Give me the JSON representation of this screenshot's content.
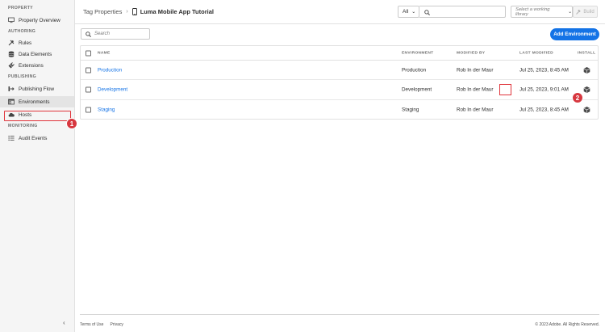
{
  "sidebar": {
    "sections": [
      {
        "label": "PROPERTY"
      },
      {
        "label": "AUTHORING"
      },
      {
        "label": "PUBLISHING"
      },
      {
        "label": "MONITORING"
      }
    ],
    "items": [
      {
        "label": "Property Overview"
      },
      {
        "label": "Rules"
      },
      {
        "label": "Data Elements"
      },
      {
        "label": "Extensions"
      },
      {
        "label": "Publishing Flow"
      },
      {
        "label": "Environments"
      },
      {
        "label": "Hosts"
      },
      {
        "label": "Audit Events"
      }
    ],
    "selected": "Environments"
  },
  "header": {
    "breadcrumb_parent": "Tag Properties",
    "breadcrumb_current": "Luma Mobile App Tutorial",
    "filter_value": "All",
    "library_placeholder": "Select a working library",
    "build_label": "Build"
  },
  "toolbar": {
    "search_placeholder": "Search",
    "add_label": "Add Environment"
  },
  "table": {
    "columns": [
      "NAME",
      "ENVIRONMENT",
      "MODIFIED BY",
      "LAST MODIFIED",
      "INSTALL"
    ],
    "rows": [
      {
        "name": "Production",
        "environment": "Production",
        "modified_by": "Rob In der Maur",
        "last_modified": "Jul 25, 2023, 8:45 AM"
      },
      {
        "name": "Development",
        "environment": "Development",
        "modified_by": "Rob In der Maur",
        "last_modified": "Jul 25, 2023, 9:01 AM"
      },
      {
        "name": "Staging",
        "environment": "Staging",
        "modified_by": "Rob In der Maur",
        "last_modified": "Jul 25, 2023, 8:45 AM"
      }
    ]
  },
  "footer": {
    "terms": "Terms of Use",
    "privacy": "Privacy",
    "copyright": "© 2023 Adobe. All Rights Reserved."
  },
  "callouts": [
    "1",
    "2"
  ],
  "colors": {
    "accent": "#1473e6",
    "callout": "#d7373f",
    "sidebar_bg": "#f5f5f5"
  }
}
